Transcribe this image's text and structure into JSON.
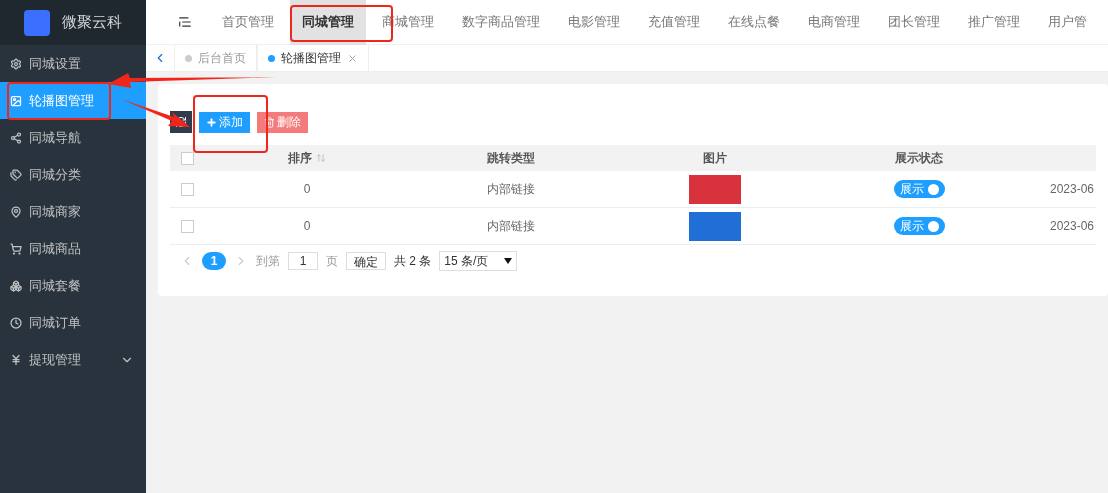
{
  "logo": {
    "text": "微聚云科"
  },
  "sidebar": {
    "items": [
      {
        "label": "同城设置",
        "selected": false
      },
      {
        "label": "轮播图管理",
        "selected": true
      },
      {
        "label": "同城导航",
        "selected": false
      },
      {
        "label": "同城分类",
        "selected": false
      },
      {
        "label": "同城商家",
        "selected": false
      },
      {
        "label": "同城商品",
        "selected": false
      },
      {
        "label": "同城套餐",
        "selected": false
      },
      {
        "label": "同城订单",
        "selected": false
      },
      {
        "label": "提现管理",
        "selected": false,
        "expandable": true
      }
    ]
  },
  "top_nav": {
    "items": [
      {
        "label": "首页管理",
        "selected": false
      },
      {
        "label": "同城管理",
        "selected": true
      },
      {
        "label": "商城管理",
        "selected": false
      },
      {
        "label": "数字商品管理",
        "selected": false
      },
      {
        "label": "电影管理",
        "selected": false
      },
      {
        "label": "充值管理",
        "selected": false
      },
      {
        "label": "在线点餐",
        "selected": false
      },
      {
        "label": "电商管理",
        "selected": false
      },
      {
        "label": "团长管理",
        "selected": false
      },
      {
        "label": "推广管理",
        "selected": false
      },
      {
        "label": "用户管",
        "selected": false
      }
    ]
  },
  "page_tabs": [
    {
      "label": "后台首页",
      "selected": false,
      "closable": false
    },
    {
      "label": "轮播图管理",
      "selected": true,
      "closable": true
    }
  ],
  "toolbar": {
    "buttons": [
      {
        "kind": "refresh"
      },
      {
        "kind": "add",
        "label": "添加"
      },
      {
        "kind": "delete",
        "label": "删除"
      }
    ]
  },
  "table": {
    "select_all_checked": false,
    "columns": [
      {
        "label": "排序",
        "sortable": true
      },
      {
        "label": "跳转类型",
        "sortable": false
      },
      {
        "label": "图片",
        "sortable": false
      },
      {
        "label": "展示状态",
        "sortable": false
      }
    ],
    "rows": [
      {
        "checked": false,
        "sort": "0",
        "link_type": "内部链接",
        "status": {
          "label": "展示",
          "on": true
        },
        "column_6": "2023-06"
      },
      {
        "checked": false,
        "sort": "0",
        "link_type": "内部链接",
        "status": {
          "label": "展示",
          "on": true
        },
        "column_6": "2023-06"
      }
    ]
  },
  "pagination": {
    "pages": [
      {
        "label": "1",
        "selected": true
      }
    ],
    "goto_label": "到第",
    "goto_value": "1",
    "page_unit": "页",
    "confirm": "确定",
    "total": "共 2 条",
    "page_size": "15 条/页"
  }
}
